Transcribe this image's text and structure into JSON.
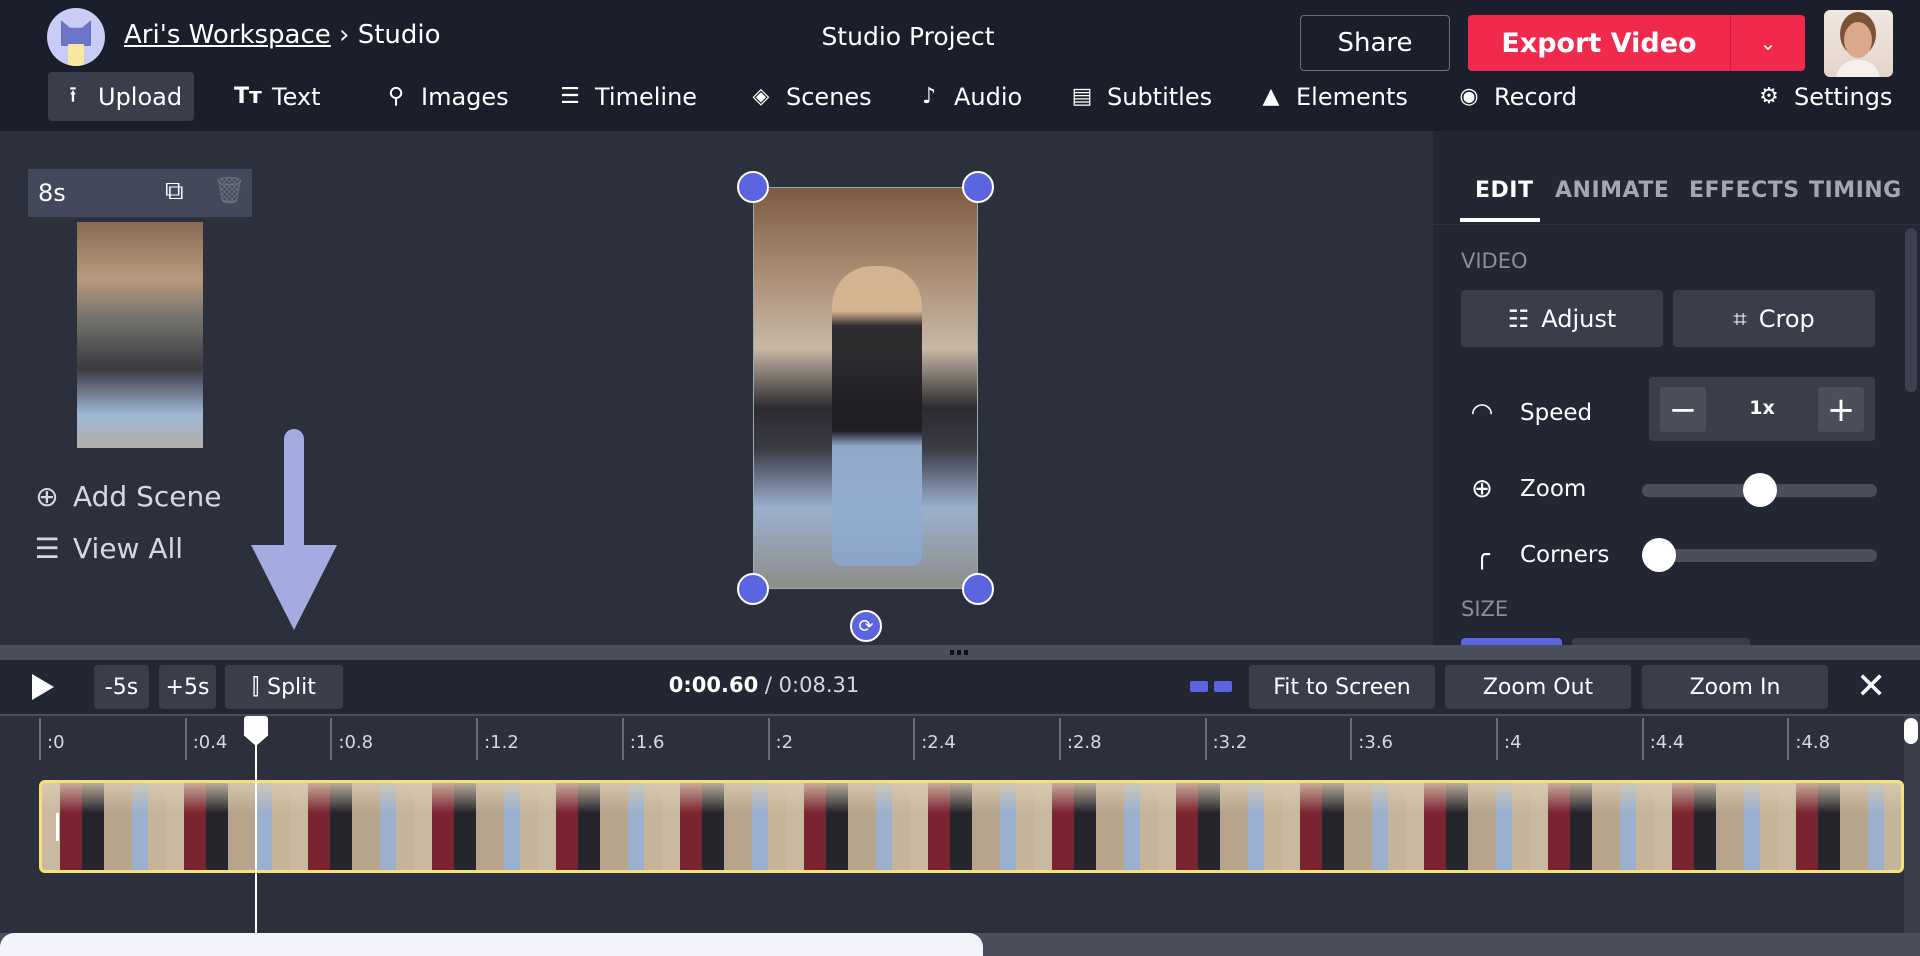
{
  "header": {
    "workspace": "Ari's Workspace",
    "separator": "›",
    "section": "Studio",
    "project_title": "Studio Project",
    "share_label": "Share",
    "export_label": "Export Video",
    "export_dropdown_icon": "chevron-down-icon"
  },
  "nav": [
    {
      "label": "Upload",
      "icon": "upload-icon",
      "active": true
    },
    {
      "label": "Text",
      "icon": "text-icon"
    },
    {
      "label": "Images",
      "icon": "search-icon"
    },
    {
      "label": "Timeline",
      "icon": "timeline-icon"
    },
    {
      "label": "Scenes",
      "icon": "layers-icon"
    },
    {
      "label": "Audio",
      "icon": "music-note-icon"
    },
    {
      "label": "Subtitles",
      "icon": "subtitles-icon"
    },
    {
      "label": "Elements",
      "icon": "shapes-icon"
    },
    {
      "label": "Record",
      "icon": "record-icon"
    },
    {
      "label": "Settings",
      "icon": "gear-icon"
    }
  ],
  "scenes": {
    "duration": "8s",
    "add_scene": "Add Scene",
    "view_all": "View All"
  },
  "panel": {
    "tabs": [
      "EDIT",
      "ANIMATE",
      "EFFECTS",
      "TIMING"
    ],
    "active_tab": "EDIT",
    "video_section": "VIDEO",
    "adjust": "Adjust",
    "crop": "Crop",
    "speed_label": "Speed",
    "speed_value": "1x",
    "zoom_label": "Zoom",
    "zoom_level": 0.5,
    "corners_label": "Corners",
    "corners_level": 0,
    "size_section": "SIZE"
  },
  "timeline": {
    "minus5": "-5s",
    "plus5": "+5s",
    "split": "Split",
    "current_time": "0:00.60",
    "separator": " / ",
    "total_time": "0:08.31",
    "fit": "Fit to Screen",
    "zoom_out": "Zoom Out",
    "zoom_in": "Zoom In",
    "ticks": [
      ":0",
      ":0.4",
      ":0.8",
      ":1.2",
      ":1.6",
      ":2",
      ":2.4",
      ":2.8",
      ":3.2",
      ":3.6",
      ":4",
      ":4.4",
      ":4.8"
    ]
  },
  "colors": {
    "accent": "#5b65e0",
    "export": "#f0294d",
    "clip_border": "#f5e17a"
  }
}
